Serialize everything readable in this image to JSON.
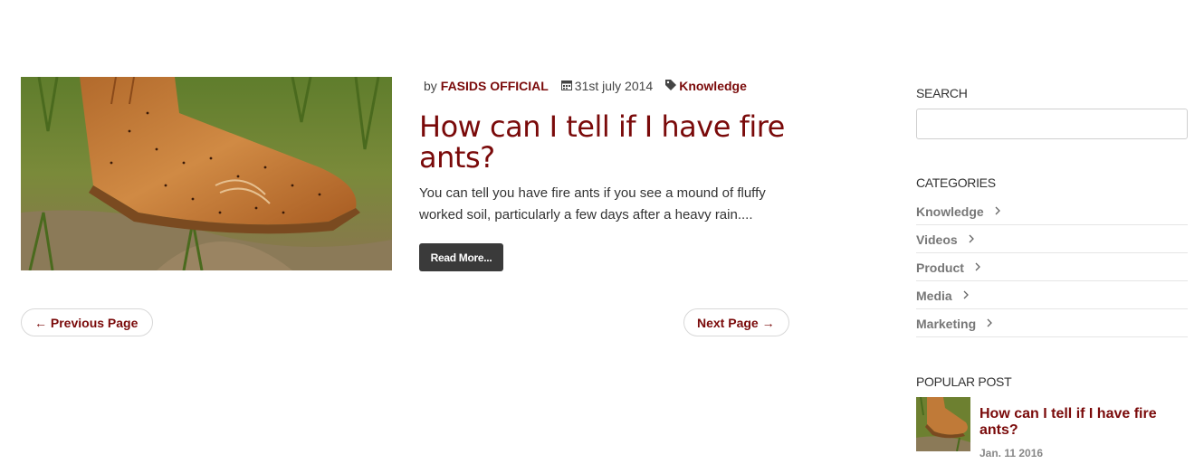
{
  "post": {
    "by_label": "by",
    "author": "FASIDS OFFICIAL",
    "date": "31st july 2014",
    "category": "Knowledge",
    "title": "How can I tell if I have fire ants?",
    "excerpt": "You can tell you have fire ants if you see a mound of fluffy worked soil, particularly a few days after a heavy rain....",
    "read_more_label": "Read More..."
  },
  "pagination": {
    "previous_label": "← Previous Page",
    "next_label": "Next Page →"
  },
  "sidebar": {
    "search_title": "SEARCH",
    "search_value": "",
    "categories_title": "CATEGORIES",
    "categories": [
      {
        "label": "Knowledge"
      },
      {
        "label": "Videos"
      },
      {
        "label": "Product"
      },
      {
        "label": "Media"
      },
      {
        "label": "Marketing"
      }
    ],
    "popular_title": "POPULAR POST",
    "popular_post": {
      "title": "How can I tell if I have fire ants?",
      "date": "Jan. 11 2016"
    }
  },
  "colors": {
    "accent": "#7a0a0a",
    "button_dark": "#3a3a3a"
  },
  "icons": [
    "calendar-icon",
    "tag-icon",
    "chevron-right-icon"
  ]
}
